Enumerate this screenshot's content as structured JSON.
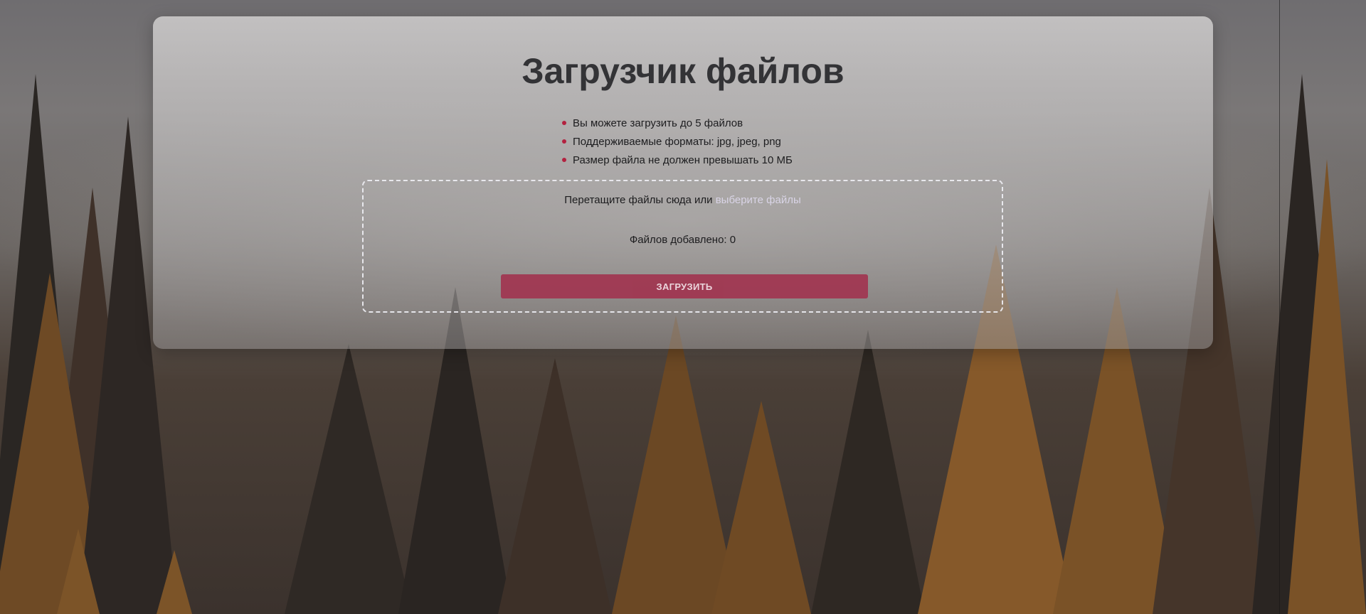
{
  "page": {
    "title": "Загрузчик файлов"
  },
  "rules": [
    "Вы можете загрузить до 5 файлов",
    "Поддерживаемые форматы: jpg, jpeg, png",
    "Размер файла не должен превышать 10 МБ"
  ],
  "dropzone": {
    "prompt": "Перетащите файлы сюда или",
    "link": "выберите файлы"
  },
  "files_added": "Файлов добавлено: 0",
  "upload_button": "ЗАГРУЗИТЬ",
  "colors": {
    "accent": "#b3213f",
    "button": "#a13550",
    "title": "#333336"
  }
}
